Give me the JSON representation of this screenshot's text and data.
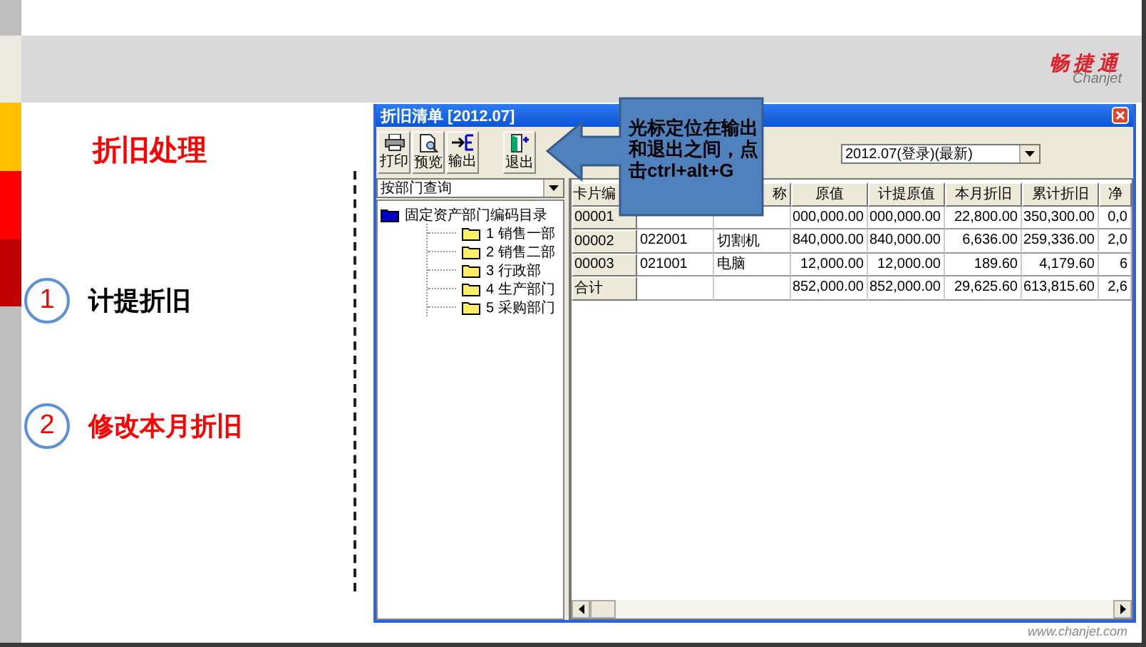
{
  "header": {
    "logo": "畅捷通",
    "logo_sub": "Chanjet"
  },
  "section_title": "折旧处理",
  "steps": [
    {
      "number": "1",
      "label": "计提折旧",
      "color": "#000000"
    },
    {
      "number": "2",
      "label": "修改本月折旧",
      "color": "#ff0000"
    }
  ],
  "window": {
    "title": "折旧清单 [2012.07]",
    "toolbar": [
      {
        "label": "打印",
        "kind": "print"
      },
      {
        "label": "预览",
        "kind": "preview"
      },
      {
        "label": "输出",
        "kind": "export"
      },
      {
        "label": "退出",
        "kind": "exit"
      }
    ],
    "period_select": {
      "value": "2012.07(登录)(最新)"
    },
    "query_select": {
      "value": "按部门查询"
    },
    "tree": [
      {
        "label": "固定资产部门编码目录",
        "children": [
          {
            "label": "1 销售一部"
          },
          {
            "label": "2 销售二部"
          },
          {
            "label": "3 行政部"
          },
          {
            "label": "4 生产部门"
          },
          {
            "label": "5 采购部门"
          }
        ]
      }
    ],
    "table": {
      "columns": {
        "column_1": "卡片编",
        "column_3": "称",
        "column_4": "原值",
        "column_5": "计提原值",
        "column_6": "本月折旧",
        "column_7": "累计折旧",
        "column_8": "净"
      },
      "rows": [
        {
          "column_1": "00001",
          "column_4": "000,000.00",
          "column_5": "000,000.00",
          "column_6": "22,800.00",
          "column_7": "350,300.00",
          "column_8": "0,0"
        },
        {
          "column_1": "00002",
          "column_2": "022001",
          "column_3": "切割机",
          "column_4": "840,000.00",
          "column_5": "840,000.00",
          "column_6": "6,636.00",
          "column_7": "259,336.00",
          "column_8": "2,0"
        },
        {
          "column_1": "00003",
          "column_2": "021001",
          "column_3": "电脑",
          "column_4": "12,000.00",
          "column_5": "12,000.00",
          "column_6": "189.60",
          "column_7": "4,179.60",
          "column_8": "6"
        },
        {
          "column_1": "合计",
          "column_4": "852,000.00",
          "column_5": "852,000.00",
          "column_6": "29,625.60",
          "column_7": "613,815.60",
          "column_8": "2,6"
        }
      ]
    }
  },
  "callout": {
    "text": "光标定位在输出和退出之间，点击ctrl+alt+G"
  },
  "footer": {
    "url": "www.chanjet.com"
  }
}
